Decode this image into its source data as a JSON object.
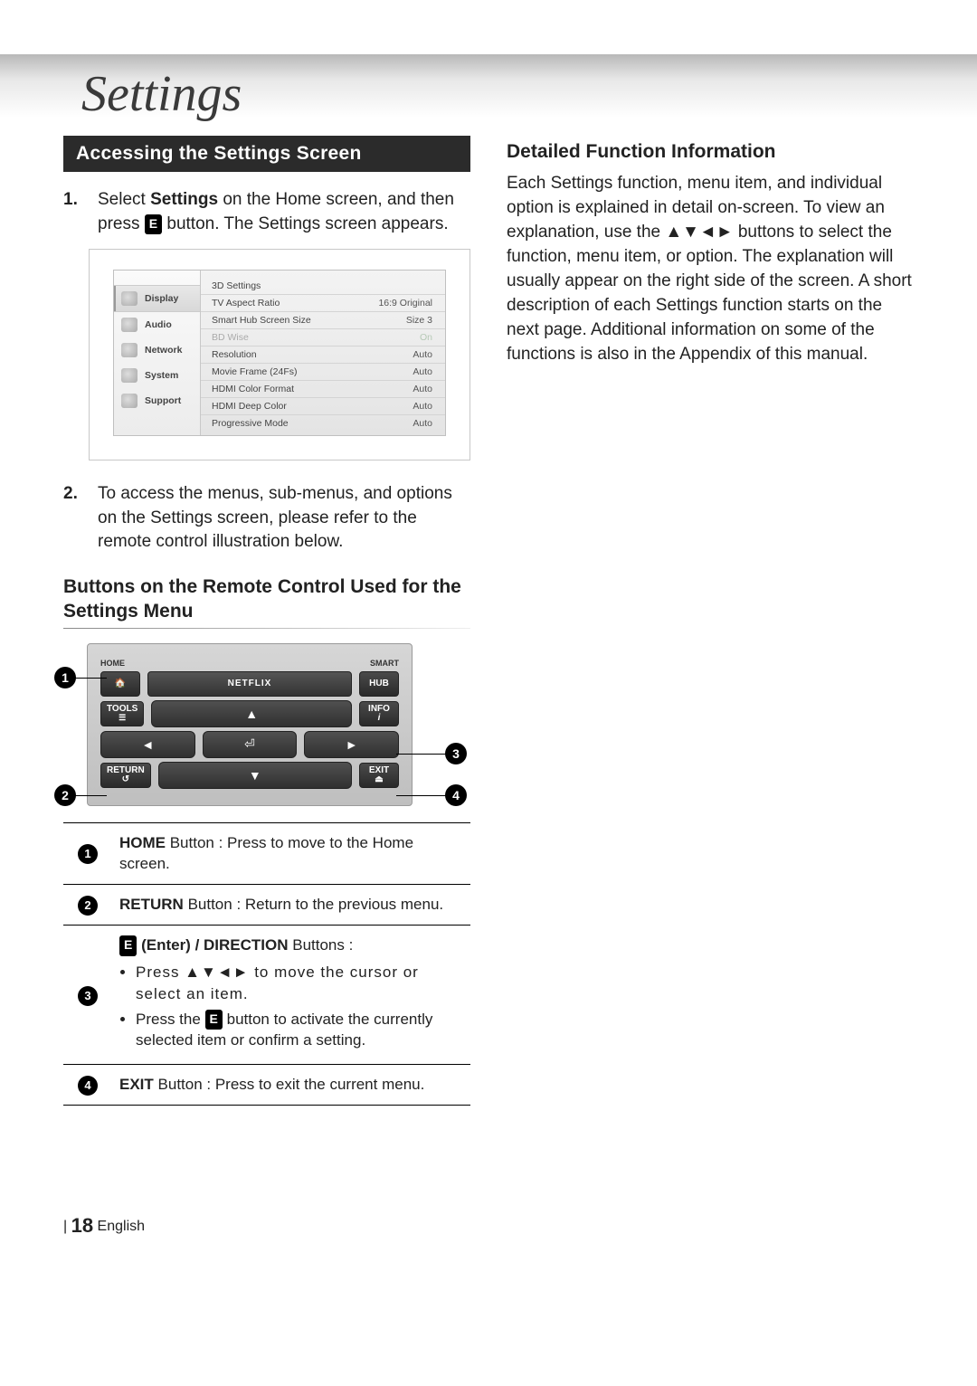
{
  "page_title": "Settings",
  "section_heading": "Accessing the Settings Screen",
  "steps": [
    {
      "num": "1.",
      "pre": "Select ",
      "bold1": "Settings",
      "mid": " on the Home screen, and then press ",
      "icon": "E",
      "post": " button. The Settings screen appears."
    },
    {
      "num": "2.",
      "text": "To access the menus, sub-menus, and options on the Settings screen, please refer to the remote control illustration below."
    }
  ],
  "sub_heading": "Buttons on the Remote Control Used for the Settings Menu",
  "right_heading": "Detailed Function Information",
  "right_body": "Each Settings function, menu item, and individual option is explained in detail on-screen. To view an explanation, use the ▲▼◄► buttons to select the function, menu item, or option. The explanation will usually appear on the right side of the screen. A short description of each Settings function starts on the next page. Additional information on some of the functions is also in the Appendix of this manual.",
  "screen": {
    "side": [
      "Display",
      "Audio",
      "Network",
      "System",
      "Support"
    ],
    "rows": [
      {
        "label": "3D Settings",
        "val": ""
      },
      {
        "label": "TV Aspect Ratio",
        "val": "16:9 Original"
      },
      {
        "label": "Smart Hub Screen Size",
        "val": "Size 3"
      },
      {
        "label": "BD Wise",
        "val": "On",
        "dim": true
      },
      {
        "label": "Resolution",
        "val": "Auto"
      },
      {
        "label": "Movie Frame (24Fs)",
        "val": "Auto"
      },
      {
        "label": "HDMI Color Format",
        "val": "Auto"
      },
      {
        "label": "HDMI Deep Color",
        "val": "Auto"
      },
      {
        "label": "Progressive Mode",
        "val": "Auto"
      }
    ]
  },
  "remote": {
    "top_left": "HOME",
    "top_right": "SMART",
    "netflix": "NETFLIX",
    "hub": "HUB",
    "tools": "TOOLS",
    "info": "INFO",
    "return": "RETURN",
    "exit": "EXIT"
  },
  "callouts": {
    "c1": "1",
    "c2": "2",
    "c3": "3",
    "c4": "4"
  },
  "table": [
    {
      "n": "1",
      "html_bold": "HOME",
      "rest": " Button : Press to move to the Home screen."
    },
    {
      "n": "2",
      "html_bold": "RETURN",
      "rest": " Button : Return to the previous menu."
    },
    {
      "n": "3",
      "lead_icon": "E",
      "lead_bold": " (Enter) / DIRECTION",
      "lead_rest": " Buttons :",
      "b1": "Press ▲▼◄► to move the cursor or select an item.",
      "b2_pre": "Press the ",
      "b2_icon": "E",
      "b2_post": " button to activate the currently selected item or confirm a setting."
    },
    {
      "n": "4",
      "html_bold": "EXIT",
      "rest": " Button : Press to exit the current menu."
    }
  ],
  "footer": {
    "bar": "|",
    "page": "18",
    "lang": "English"
  }
}
